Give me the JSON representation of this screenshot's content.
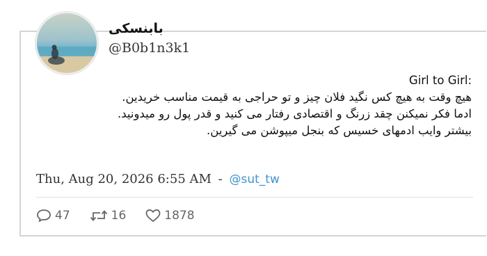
{
  "user": {
    "display_name": "بابنسکی",
    "handle": "@B0b1n3k1"
  },
  "tweet": {
    "lines": [
      ":Girl to Girl",
      "هیچ وقت به هیچ کس نگید فلان چیز و تو حراجی به قیمت مناسب خریدین.",
      "ادما فکر نمیکنن چقد زرنگ و اقتصادی رفتار می کنید و قدر پول رو میدونید.",
      "بیشتر وایب ادمهای خسیس که بنجل میپوشن می گیرین."
    ],
    "timestamp": "Thu, Aug 20, 2026 6:55 AM",
    "separator": "-",
    "via_handle": "@sut_tw"
  },
  "stats": {
    "replies": "47",
    "retweets": "16",
    "likes": "1878"
  },
  "icons": [
    "reply-icon",
    "retweet-icon",
    "like-icon"
  ],
  "colors": {
    "link": "#3f93cf",
    "border": "#d5d5d5",
    "icon": "#666666"
  }
}
